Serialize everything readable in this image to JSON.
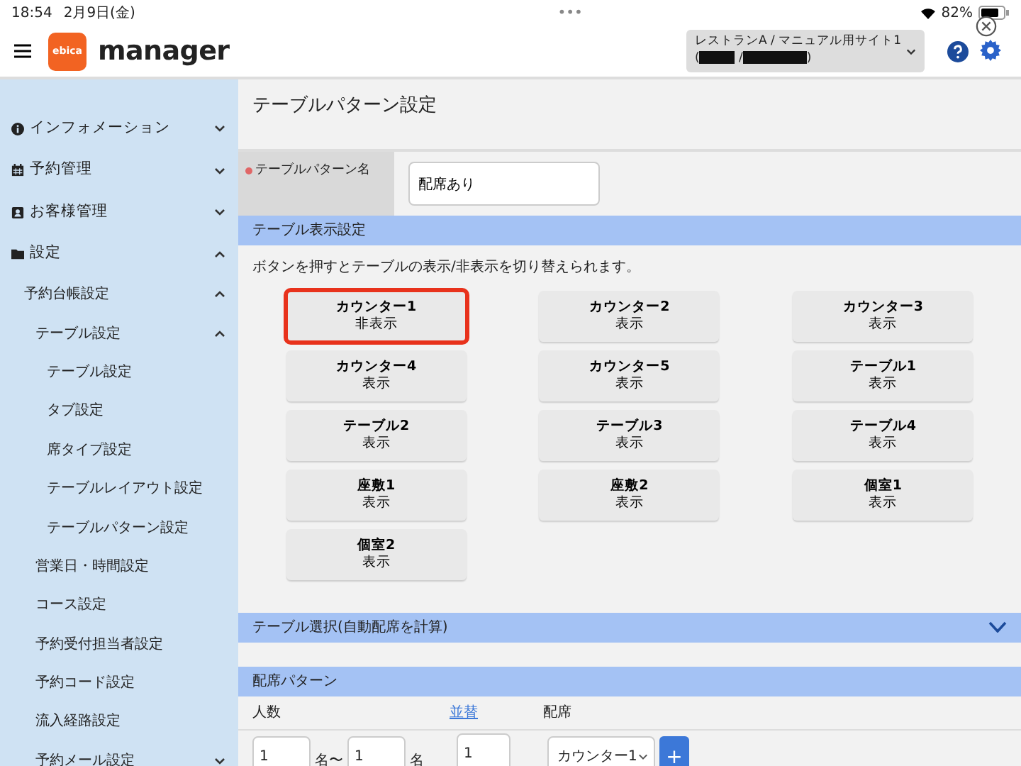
{
  "status_bar": {
    "time": "18:54",
    "date": "2月9日(金)",
    "dots": "•••",
    "battery": "82%"
  },
  "header": {
    "logo_badge": "ebica",
    "logo_text": "manager",
    "site_selector": {
      "line1": "レストランA / マニュアル用サイト1",
      "open": "(",
      "separator": "/",
      "close": ")"
    }
  },
  "sidebar": {
    "items": [
      {
        "label": "インフォメーション",
        "expanded": false
      },
      {
        "label": "予約管理",
        "expanded": false
      },
      {
        "label": "お客様管理",
        "expanded": false
      },
      {
        "label": "設定",
        "expanded": true,
        "children": [
          {
            "label": "予約台帳設定",
            "expanded": true,
            "children": [
              {
                "label": "テーブル設定",
                "expanded": true,
                "children": [
                  {
                    "label": "テーブル設定"
                  },
                  {
                    "label": "タブ設定"
                  },
                  {
                    "label": "席タイプ設定"
                  },
                  {
                    "label": "テーブルレイアウト設定"
                  },
                  {
                    "label": "テーブルパターン設定"
                  }
                ]
              },
              {
                "label": "営業日・時間設定"
              },
              {
                "label": "コース設定"
              },
              {
                "label": "予約受付担当者設定"
              },
              {
                "label": "予約コード設定"
              },
              {
                "label": "流入経路設定"
              },
              {
                "label": "予約メール設定",
                "expanded": false
              }
            ]
          }
        ]
      }
    ]
  },
  "page_title": "テーブルパターン設定",
  "pattern_name": {
    "label": "テーブルパターン名",
    "value": "配席あり"
  },
  "display_section": {
    "title": "テーブル表示設定",
    "description": "ボタンを押すとテーブルの表示/非表示を切り替えられます。",
    "tables": [
      {
        "name": "カウンター1",
        "state": "非表示",
        "selected": true
      },
      {
        "name": "カウンター2",
        "state": "表示",
        "selected": false
      },
      {
        "name": "カウンター3",
        "state": "表示",
        "selected": false
      },
      {
        "name": "カウンター4",
        "state": "表示",
        "selected": false
      },
      {
        "name": "カウンター5",
        "state": "表示",
        "selected": false
      },
      {
        "name": "テーブル1",
        "state": "表示",
        "selected": false
      },
      {
        "name": "テーブル2",
        "state": "表示",
        "selected": false
      },
      {
        "name": "テーブル3",
        "state": "表示",
        "selected": false
      },
      {
        "name": "テーブル4",
        "state": "表示",
        "selected": false
      },
      {
        "name": "座敷1",
        "state": "表示",
        "selected": false
      },
      {
        "name": "座敷2",
        "state": "表示",
        "selected": false
      },
      {
        "name": "個室1",
        "state": "表示",
        "selected": false
      },
      {
        "name": "個室2",
        "state": "表示",
        "selected": false
      }
    ]
  },
  "selection_section": {
    "title": "テーブル選択(自動配席を計算)",
    "expanded": false
  },
  "seating_section": {
    "title": "配席パターン",
    "columns": {
      "people": "人数",
      "sort": "並替",
      "seats": "配席"
    },
    "row": {
      "min": "1",
      "min_unit": "名〜",
      "max": "1",
      "max_unit": "名",
      "order": "1",
      "seat": "カウンター1",
      "add": "+"
    }
  }
}
